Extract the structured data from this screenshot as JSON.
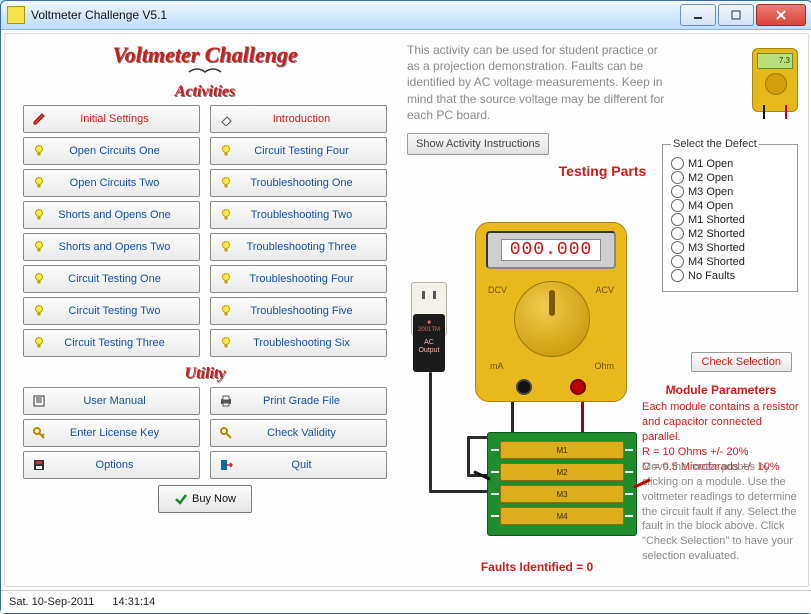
{
  "window": {
    "title": "Voltmeter Challenge V5.1"
  },
  "headings": {
    "app": "Voltmeter Challenge",
    "activities": "Activities",
    "utility": "Utility"
  },
  "activities_col1": [
    {
      "label": "Initial Settings",
      "style": "red",
      "icon": "pencil"
    },
    {
      "label": "Open Circuits One"
    },
    {
      "label": "Open Circuits Two"
    },
    {
      "label": "Shorts and Opens One"
    },
    {
      "label": "Shorts and Opens Two"
    },
    {
      "label": "Circuit Testing One"
    },
    {
      "label": "Circuit Testing Two"
    },
    {
      "label": "Circuit Testing Three"
    }
  ],
  "activities_col2": [
    {
      "label": "Introduction",
      "style": "red",
      "icon": "eraser"
    },
    {
      "label": "Circuit Testing Four"
    },
    {
      "label": "Troubleshooting One"
    },
    {
      "label": "Troubleshooting Two"
    },
    {
      "label": "Troubleshooting Three"
    },
    {
      "label": "Troubleshooting Four"
    },
    {
      "label": "Troubleshooting Five"
    },
    {
      "label": "Troubleshooting Six"
    }
  ],
  "utility_col1": [
    {
      "label": "User Manual",
      "icon": "book"
    },
    {
      "label": "Enter License Key",
      "icon": "key"
    },
    {
      "label": "Options",
      "icon": "disk"
    }
  ],
  "utility_col2": [
    {
      "label": "Print Grade File",
      "icon": "printer"
    },
    {
      "label": "Check Validity",
      "icon": "checkkey"
    },
    {
      "label": "Quit",
      "icon": "exit"
    }
  ],
  "buy_label": "Buy Now",
  "intro_text": "This activity can be used for student practice or as a projection demonstration. Faults can be identified by AC voltage measurements. Keep in mind that the source voltage may be different for each PC board.",
  "show_instructions": "Show Activity Instructions",
  "testing_header": "Testing Parts",
  "mini_meter_reading": "7.3",
  "meter": {
    "reading": "000.000",
    "labels": {
      "dcv": "DCV",
      "acv": "ACV",
      "ma": "mA",
      "ohm": "Ohm"
    }
  },
  "adapter_label": "AC Output",
  "board_modules": [
    "M1",
    "M2",
    "M3",
    "M4"
  ],
  "defect": {
    "legend": "Select the Defect",
    "options": [
      "M1 Open",
      "M2 Open",
      "M3 Open",
      "M4 Open",
      "M1 Shorted",
      "M2 Shorted",
      "M3 Shorted",
      "M4 Shorted",
      "No Faults"
    ]
  },
  "check_selection": "Check Selection",
  "module_params": {
    "heading": "Module Parameters",
    "line1": "Each module contains a resistor and capacitor connected parallel.",
    "line2": "R = 10 Ohms +/- 20%",
    "line3": "C = 0.5 Microfarads +/- 10%"
  },
  "tips": "Move the meter probes by clicking on a module. Use the voltmeter readings to determine the circuit fault if any. Select the fault in the block above. Click \"Check Selection\" to have your selection evaluated.",
  "faults_label": "Faults Identified = 0",
  "status": {
    "date": "Sat.  10-Sep-2011",
    "time": "14:31:14"
  }
}
